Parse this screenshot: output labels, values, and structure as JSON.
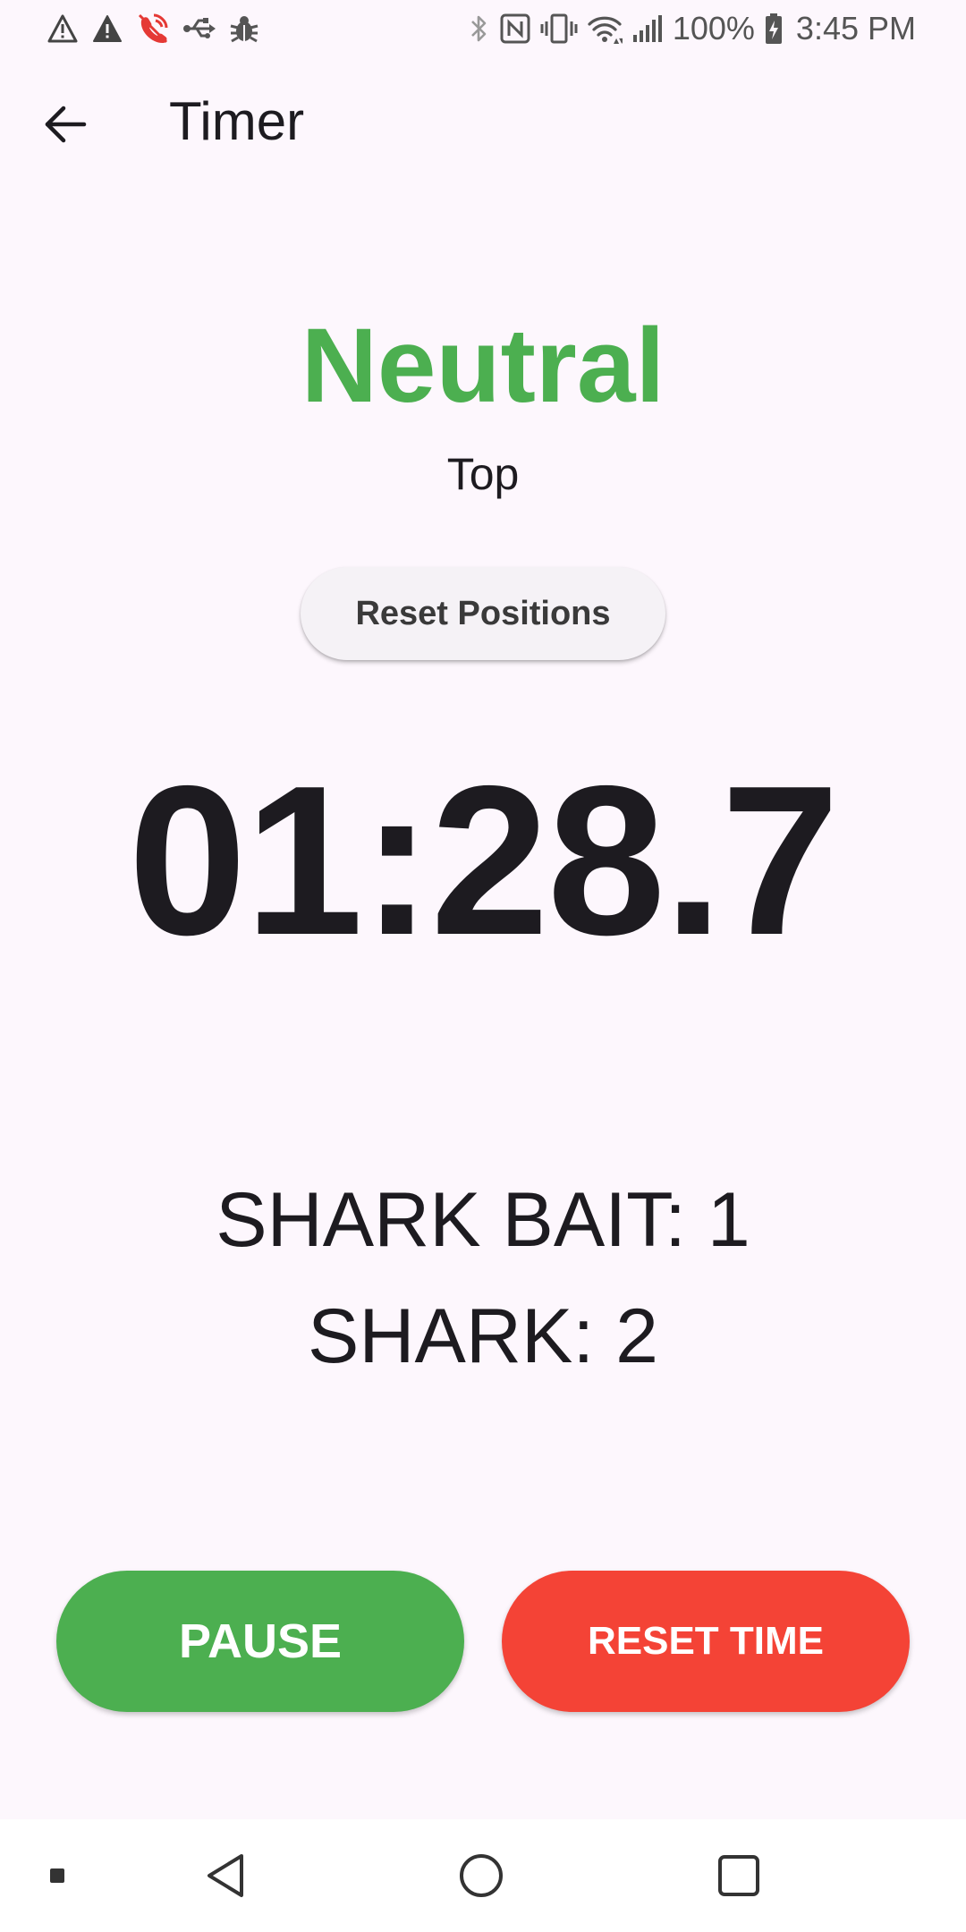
{
  "status_bar": {
    "left_icons": [
      "warning-outline-icon",
      "warning-filled-icon",
      "missed-call-icon",
      "usb-icon",
      "debug-bug-icon"
    ],
    "right_icons": [
      "bluetooth-icon",
      "nfc-icon",
      "vibrate-icon",
      "wifi-icon",
      "signal-icon",
      "battery-charging-icon"
    ],
    "battery": "100%",
    "time": "3:45 PM"
  },
  "app_bar": {
    "title": "Timer"
  },
  "position": {
    "title": "Neutral",
    "subtitle": "Top"
  },
  "reset_positions_label": "Reset Positions",
  "timer": {
    "display": "01:28.7"
  },
  "scores": [
    {
      "text": "SHARK BAIT: 1"
    },
    {
      "text": "SHARK: 2"
    }
  ],
  "actions": {
    "pause_label": "PAUSE",
    "reset_time_label": "RESET TIME"
  },
  "nav_bar": {
    "items": [
      "recents-indicator-icon",
      "back-triangle-icon",
      "home-circle-icon",
      "overview-square-icon"
    ]
  },
  "colors": {
    "background": "#fdf7fd",
    "neutral_green": "#4caf50",
    "pause_green": "#4caf50",
    "reset_red": "#f44336",
    "missed_call_red": "#e53935"
  }
}
